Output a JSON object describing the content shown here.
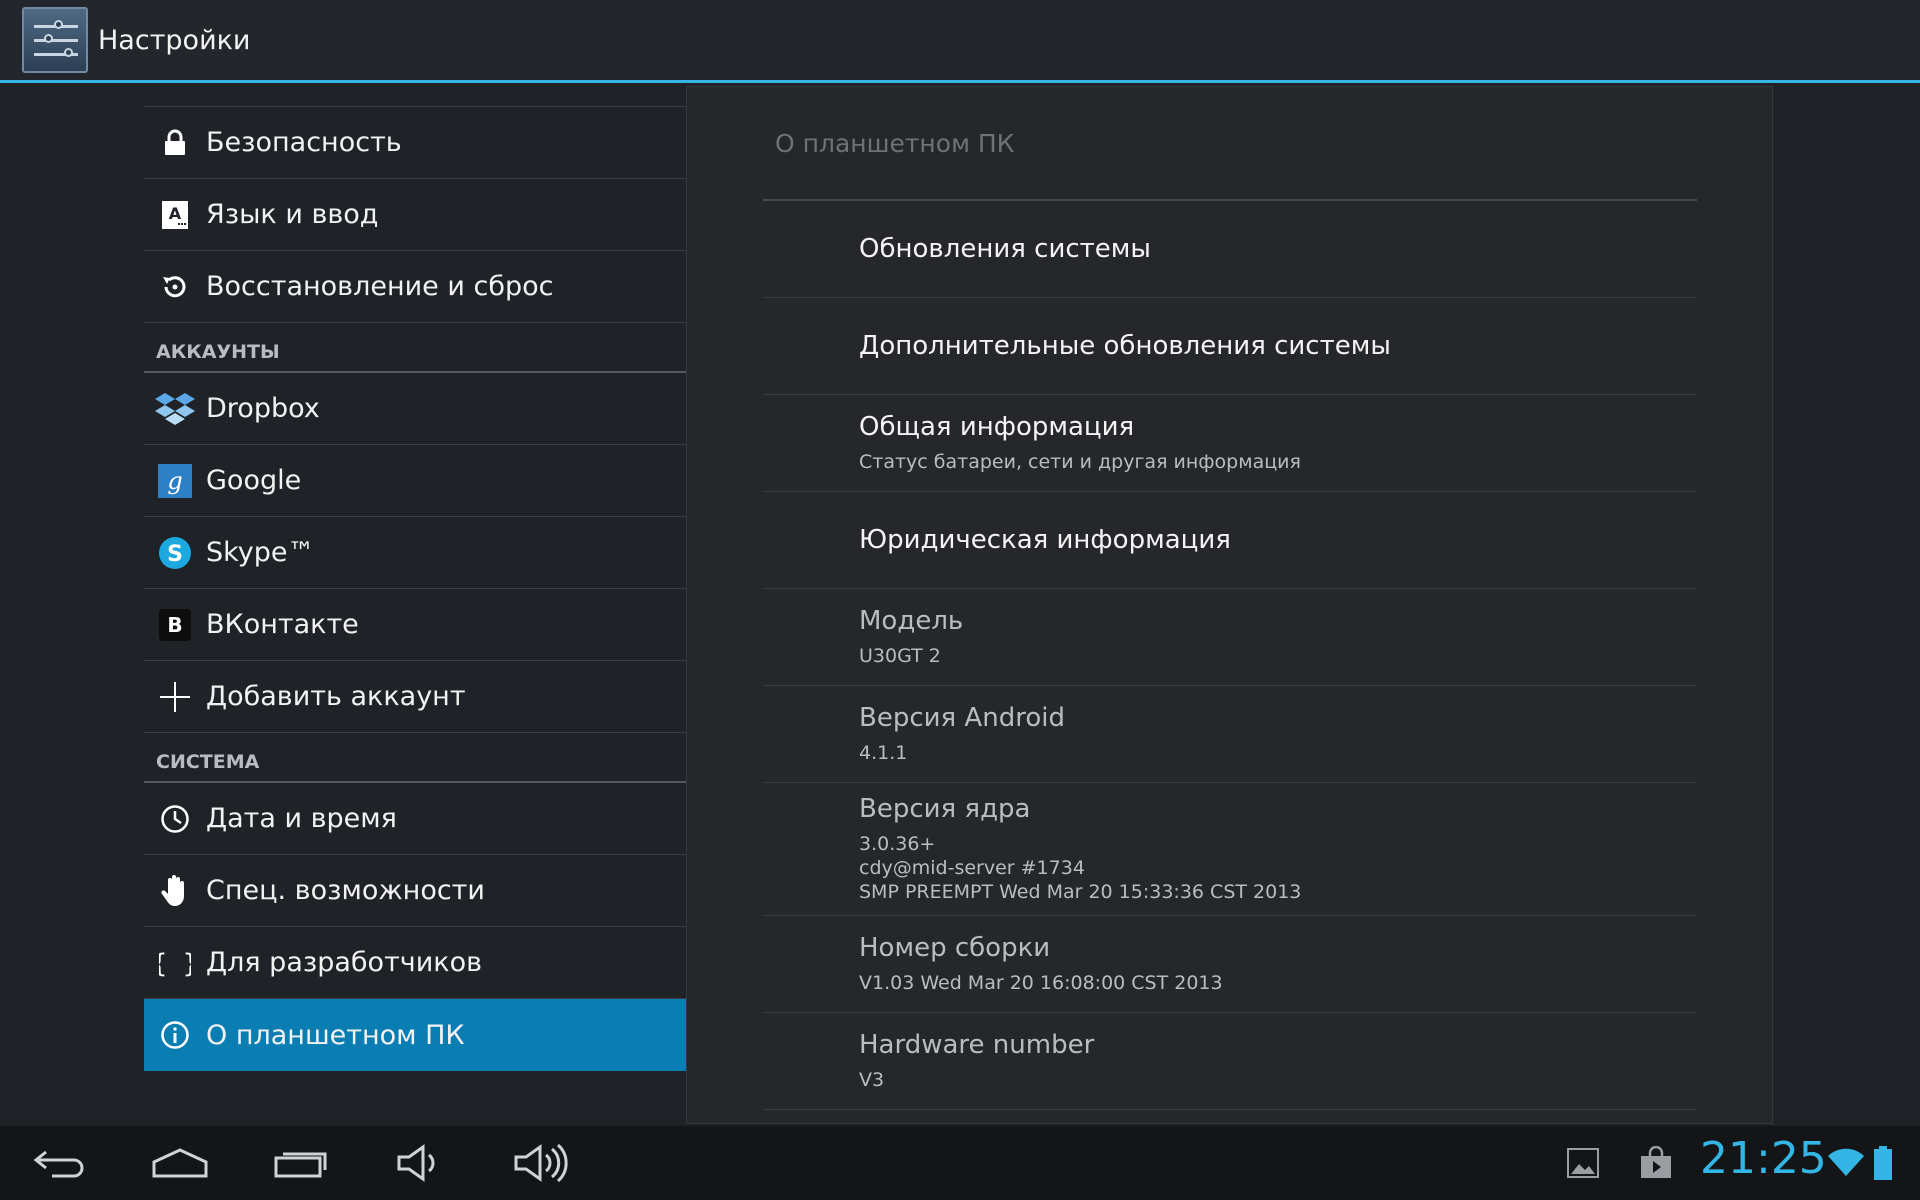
{
  "app": {
    "title": "Настройки"
  },
  "sidebar": {
    "items_top": [
      {
        "label": "Безопасность",
        "icon": "lock-icon"
      },
      {
        "label": "Язык и ввод",
        "icon": "keyboard-language-icon"
      },
      {
        "label": "Восстановление и сброс",
        "icon": "restore-icon"
      }
    ],
    "accounts_header": "АККАУНТЫ",
    "accounts": [
      {
        "label": "Dropbox",
        "icon": "dropbox-icon"
      },
      {
        "label": "Google",
        "icon": "google-icon"
      },
      {
        "label": "Skype™",
        "icon": "skype-icon"
      },
      {
        "label": "ВКонтакте",
        "icon": "vk-icon"
      },
      {
        "label": "Добавить аккаунт",
        "icon": "add-icon"
      }
    ],
    "system_header": "СИСТЕМА",
    "system": [
      {
        "label": "Дата и время",
        "icon": "clock-icon"
      },
      {
        "label": "Спец. возможности",
        "icon": "hand-icon"
      },
      {
        "label": "Для разработчиков",
        "icon": "braces-icon"
      },
      {
        "label": "О планшетном ПК",
        "icon": "info-icon",
        "selected": true
      }
    ]
  },
  "detail": {
    "title": "О планшетном ПК",
    "items": [
      {
        "title": "Обновления системы"
      },
      {
        "title": "Дополнительные обновления системы"
      },
      {
        "title": "Общая информация",
        "summary": "Статус батареи, сети и другая информация"
      },
      {
        "title": "Юридическая информация"
      },
      {
        "title": "Модель",
        "summary": "U30GT 2"
      },
      {
        "title": "Версия Android",
        "summary": "4.1.1"
      },
      {
        "title": "Версия ядра",
        "summary_lines": [
          "3.0.36+",
          "cdy@mid-server #1734",
          "SMP PREEMPT Wed Mar 20 15:33:36 CST 2013"
        ]
      },
      {
        "title": "Номер сборки",
        "summary": "V1.03 Wed Mar 20 16:08:00 CST 2013"
      },
      {
        "title": "Hardware number",
        "summary": "V3"
      }
    ]
  },
  "navbar": {
    "buttons": [
      "back-icon",
      "home-icon",
      "recent-apps-icon",
      "volume-down-icon",
      "volume-up-icon"
    ],
    "clock": "21:25",
    "status_icons": [
      "gallery-notification-icon",
      "store-notification-icon",
      "wifi-icon",
      "battery-icon"
    ]
  },
  "colors": {
    "accent": "#33b5e5",
    "selected": "#0a7db3"
  }
}
